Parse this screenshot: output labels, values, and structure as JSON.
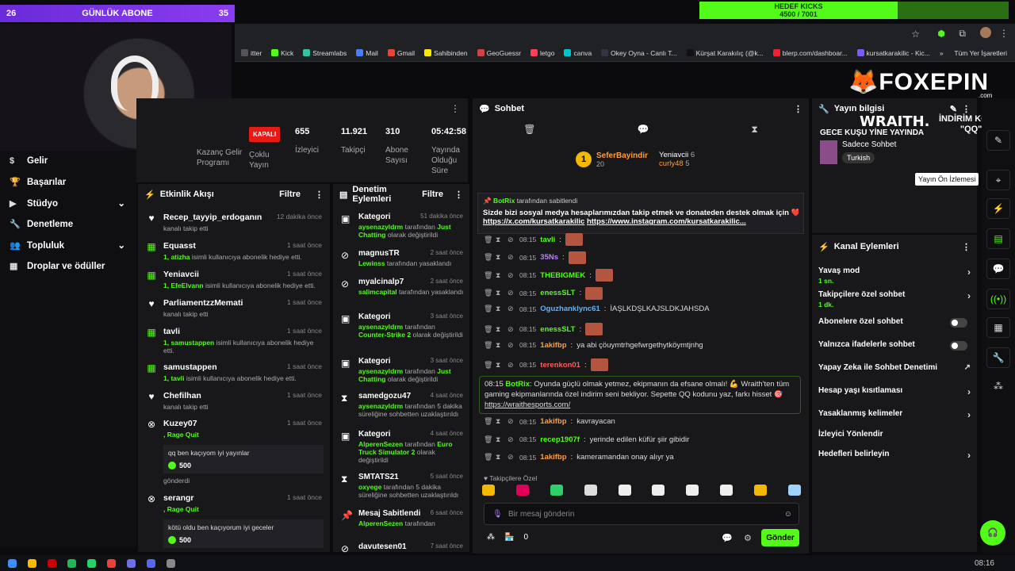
{
  "overlay": {
    "sub_left": "26",
    "sub_title": "GÜNLÜK ABONE",
    "sub_right": "35",
    "kick_goal_title": "HEDEF KICKS",
    "kick_goal_value": "4500 / 7001",
    "logo": "FOXEPIN",
    "logo_sub": ".com",
    "sponsor": "WRAITH.",
    "promo_line1": "İNDİRİM KODU:",
    "promo_line2": "\"QQ\""
  },
  "bookmarks": [
    {
      "label": "itter",
      "color": "#555555"
    },
    {
      "label": "Kick",
      "color": "#53fc18"
    },
    {
      "label": "Streamlabs",
      "color": "#31c3a2"
    },
    {
      "label": "Mail",
      "color": "#4a7dfc"
    },
    {
      "label": "Gmail",
      "color": "#ea4335"
    },
    {
      "label": "Sahibinden",
      "color": "#ffe800"
    },
    {
      "label": "GeoGuessr",
      "color": "#c44"
    },
    {
      "label": "letgo",
      "color": "#ff3f55"
    },
    {
      "label": "canva",
      "color": "#00c4cc"
    },
    {
      "label": "Okey Oyna - Canlı T...",
      "color": "#334"
    },
    {
      "label": "Kürşat Karakılıç (@k...",
      "color": "#111"
    },
    {
      "label": "blerp.com/dashboar...",
      "color": "#e23"
    },
    {
      "label": "kursatkarakilic - Kic...",
      "color": "#7a5af8"
    }
  ],
  "bookmarks_more": "»",
  "bookmarks_folder": "Tüm Yer İşaretleri",
  "nav": [
    {
      "label": "Gelir",
      "icon": "dollar-icon",
      "chev": ""
    },
    {
      "label": "Başarılar",
      "icon": "trophy-icon",
      "chev": ""
    },
    {
      "label": "Stüdyo",
      "icon": "video-icon",
      "chev": "⌄"
    },
    {
      "label": "Denetleme",
      "icon": "wrench-icon",
      "chev": ""
    },
    {
      "label": "Topluluk",
      "icon": "users-icon",
      "chev": "⌄"
    },
    {
      "label": "Droplar ve ödüller",
      "icon": "gift-icon",
      "chev": ""
    }
  ],
  "stats": {
    "revenue_label": "Kazanç Gelir Programı",
    "status_badge": "KAPALI",
    "status_label": "Çoklu Yayın",
    "viewers": "655",
    "viewers_label": "İzleyici",
    "followers": "11.921",
    "followers_label": "Takipçi",
    "subs": "310",
    "subs_label": "Abone Sayısı",
    "uptime": "05:42:58",
    "uptime_label": "Yayında Olduğu Süre"
  },
  "activity": {
    "title": "Etkinlik Akışı",
    "filter": "Filtre",
    "events": [
      {
        "icon": "heart-icon",
        "name": "Recep_tayyip_erdoganın",
        "time": "12 dakika önce",
        "desc": "kanalı takip etti",
        "hl": "",
        "quote": "",
        "points": ""
      },
      {
        "icon": "gift-icon",
        "name": "Equasst",
        "time": "1 saat önce",
        "desc": "isimli kullanıcıya abonelik hediye etti.",
        "hl": "1, atizha",
        "quote": "",
        "points": ""
      },
      {
        "icon": "gift-icon",
        "name": "Yeniavcii",
        "time": "1 saat önce",
        "desc": "isimli kullanıcıya abonelik hediye etti.",
        "hl": "1, EfeElvann",
        "quote": "",
        "points": ""
      },
      {
        "icon": "heart-icon",
        "name": "ParliamentzzMemati",
        "time": "1 saat önce",
        "desc": "kanalı takip etti",
        "hl": "",
        "quote": "",
        "points": ""
      },
      {
        "icon": "gift-icon",
        "name": "tavli",
        "time": "1 saat önce",
        "desc": "isimli kullanıcıya abonelik hediye etti.",
        "hl": "1, samustappen",
        "quote": "",
        "points": ""
      },
      {
        "icon": "gift-icon",
        "name": "samustappen",
        "time": "1 saat önce",
        "desc": "isimli kullanıcıya abonelik hediye etti.",
        "hl": "1, tavli",
        "quote": "",
        "points": ""
      },
      {
        "icon": "heart-icon",
        "name": "Chefilhan",
        "time": "1 saat önce",
        "desc": "kanalı takip etti",
        "hl": "",
        "quote": "",
        "points": ""
      },
      {
        "icon": "kick-icon",
        "name": "Kuzey07",
        "time": "1 saat önce",
        "desc": "",
        "hl": ", Rage Quit",
        "quote": "qq ben kaçıyom iyi yayınlar",
        "points": "500",
        "after": "gönderdi"
      },
      {
        "icon": "kick-icon",
        "name": "serangr",
        "time": "1 saat önce",
        "desc": "",
        "hl": ", Rage Quit",
        "quote": "kötü oldu ben kaçıyorum iyi geceler",
        "points": "500",
        "after": ""
      }
    ]
  },
  "mod": {
    "title": "Denetim Eylemleri",
    "filter": "Filtre",
    "events": [
      {
        "icon": "category-icon",
        "name": "Kategori",
        "time": "51 dakika önce",
        "pre": "aysenazyldrm",
        "desc": "tarafından",
        "post": "Just Chatting",
        "tail": "olarak değiştirildi"
      },
      {
        "icon": "ban-icon",
        "name": "magnusTR",
        "time": "2 saat önce",
        "pre": "Lewinss",
        "desc": "tarafından yasaklandı",
        "post": "",
        "tail": ""
      },
      {
        "icon": "ban-icon",
        "name": "myalcinalp7",
        "time": "2 saat önce",
        "pre": "salimcapital",
        "desc": "tarafından yasaklandı",
        "post": "",
        "tail": ""
      },
      {
        "icon": "category-icon",
        "name": "Kategori",
        "time": "3 saat önce",
        "pre": "aysenazyldrm",
        "desc": "tarafından",
        "post": "Counter-Strike 2",
        "tail": "olarak değiştirildi"
      },
      {
        "icon": "category-icon",
        "name": "Kategori",
        "time": "3 saat önce",
        "pre": "aysenazyldrm",
        "desc": "tarafından",
        "post": "Just Chatting",
        "tail": "olarak değiştirildi"
      },
      {
        "icon": "timeout-icon",
        "name": "samedgozu47",
        "time": "4 saat önce",
        "pre": "aysenazyldrm",
        "desc": "tarafından 5 dakika süreliğine sohbetten uzaklaştırıldı",
        "post": "",
        "tail": ""
      },
      {
        "icon": "category-icon",
        "name": "Kategori",
        "time": "4 saat önce",
        "pre": "AlperenSezen",
        "desc": "tarafından",
        "post": "Euro Truck Simulator 2",
        "tail": "olarak değiştirildi"
      },
      {
        "icon": "timeout-icon",
        "name": "SMTATS21",
        "time": "5 saat önce",
        "pre": "oxyege",
        "desc": "tarafından 5 dakika süreliğine sohbetten uzaklaştırıldı",
        "post": "",
        "tail": ""
      },
      {
        "icon": "pin-icon",
        "name": "Mesaj Sabitlendi",
        "time": "6 saat önce",
        "pre": "AlperenSezen",
        "desc": "tarafından",
        "post": "",
        "tail": ""
      },
      {
        "icon": "ban-icon",
        "name": "davutesen01",
        "time": "7 saat önce",
        "pre": "",
        "desc": "",
        "post": "",
        "tail": ""
      }
    ]
  },
  "chat": {
    "title": "Sohbet",
    "top_gifter_1": "SeferBayindir",
    "top_gifter_1_count": "20",
    "top_gifter_2": "Yeniavcii",
    "top_gifter_2_count": "6",
    "top_gifter_3": "curly48",
    "top_gifter_3_count": "5",
    "pinned_by": "BotRix",
    "pinned_by_suffix": "tarafından sabitlendi",
    "pinned_text": "Sizde bizi sosyal medya hesaplarımızdan takip etmek ve donateden destek olmak için ❤️ ;",
    "pinned_link1": "https://x.com/kursatkarakilic",
    "pinned_link2": "https://www.instagram.com/kursatkarakilic...",
    "messages": [
      {
        "time": "08:15",
        "user": "tavli",
        "cls": "u-green",
        "text": "",
        "emote": true
      },
      {
        "time": "08:15",
        "user": "35Ns",
        "cls": "u-purple",
        "text": "",
        "emote": true
      },
      {
        "time": "08:15",
        "user": "THEBIGMEK",
        "cls": "u-green",
        "text": "",
        "emote": true
      },
      {
        "time": "08:15",
        "user": "enessSLT",
        "cls": "u-green",
        "text": "",
        "emote": true
      },
      {
        "time": "08:15",
        "user": "Oguzhanklync61",
        "cls": "u-blue",
        "text": "İAŞLKDŞLKAJSLDKJAHSDA",
        "emote": false
      },
      {
        "time": "08:15",
        "user": "enessSLT",
        "cls": "u-green",
        "text": "",
        "emote": true
      },
      {
        "time": "08:15",
        "user": "1akifbp",
        "cls": "u-orange",
        "text": "ya abi çöuymtrhgefwrgethytköymtjnhg",
        "emote": false
      },
      {
        "time": "08:15",
        "user": "terenkon01",
        "cls": "u-red",
        "text": "",
        "emote": true
      }
    ],
    "bot_time": "08:15",
    "bot_user": "BotRix",
    "bot_text": "Oyunda güçlü olmak yetmez, ekipmanın da efsane olmalı! 💪 Wraith'ten tüm gaming ekipmanlarında özel indirim seni bekliyor. Sepette QQ kodunu yaz, farkı hisset 🎯",
    "bot_link": "https://wraithesports.com/",
    "messages2": [
      {
        "time": "08:15",
        "user": "1akifbp",
        "cls": "u-orange",
        "text": "kavrayacan"
      },
      {
        "time": "08:15",
        "user": "recep1907f",
        "cls": "u-green",
        "text": "yerinde edilen küfür şiir gibidir"
      },
      {
        "time": "08:15",
        "user": "1akifbp",
        "cls": "u-orange",
        "text": "kameramandan onay alıyr ya"
      }
    ],
    "emote_section": "Takipçilere Özel",
    "input_placeholder": "Bir mesaj gönderin",
    "points": "0",
    "send": "Gönder"
  },
  "info": {
    "title": "Yayın bilgisi",
    "stream_title": "GECE KUŞU YİNE YAYINDA",
    "category": "Sadece Sohbet",
    "language": "Turkish"
  },
  "actions": {
    "title": "Kanal Eylemleri",
    "items": [
      {
        "label": "Yavaş mod",
        "sub": "1 sn.",
        "ctrl": "arrow"
      },
      {
        "label": "Takipçilere özel sohbet",
        "sub": "1 dk.",
        "ctrl": "arrow"
      },
      {
        "label": "Abonelere özel sohbet",
        "sub": "",
        "ctrl": "toggle"
      },
      {
        "label": "Yalnızca ifadelerle sohbet",
        "sub": "",
        "ctrl": "toggle"
      },
      {
        "label": "Yapay Zeka ile Sohbet Denetimi",
        "sub": "",
        "ctrl": "ext"
      },
      {
        "label": "Hesap yaşı kısıtlaması",
        "sub": "",
        "ctrl": "arrow"
      },
      {
        "label": "Yasaklanmış kelimeler",
        "sub": "",
        "ctrl": "arrow"
      },
      {
        "label": "İzleyici Yönlendir",
        "sub": "",
        "ctrl": ""
      },
      {
        "label": "Hedefleri belirleyin",
        "sub": "",
        "ctrl": "arrow"
      }
    ]
  },
  "tooltip": "Yayın Ön İzlemesi",
  "clock": "08:16"
}
